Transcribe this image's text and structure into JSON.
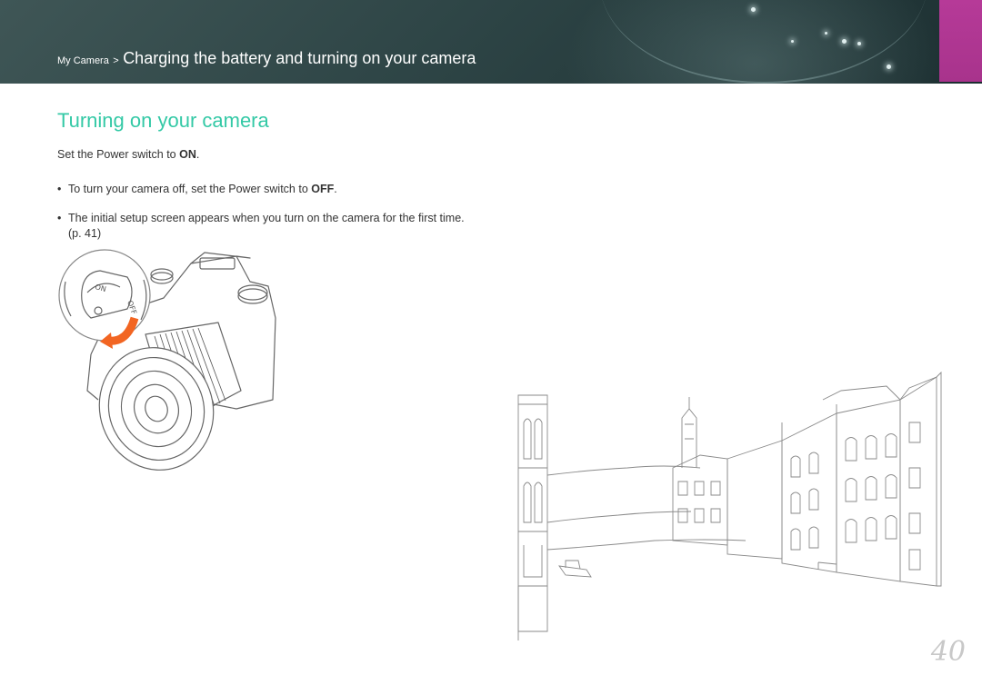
{
  "header": {
    "breadcrumb_parent": "My Camera",
    "breadcrumb_separator": ">",
    "breadcrumb_title": "Charging the battery and turning on your camera"
  },
  "section_title": "Turning on your camera",
  "step": {
    "prefix": "Set the Power switch to ",
    "value": "ON",
    "suffix": "."
  },
  "bullets": [
    {
      "prefix": "To turn your camera off, set the Power switch to ",
      "value": "OFF",
      "suffix": "."
    },
    {
      "text": "The initial setup screen appears when you turn on the camera for the first time. (p. 41)"
    }
  ],
  "page_number": "40",
  "colors": {
    "header_bg": "#2e4546",
    "tab_accent": "#b63a98",
    "title_color": "#34c9a6",
    "arrow_color": "#f26522"
  }
}
